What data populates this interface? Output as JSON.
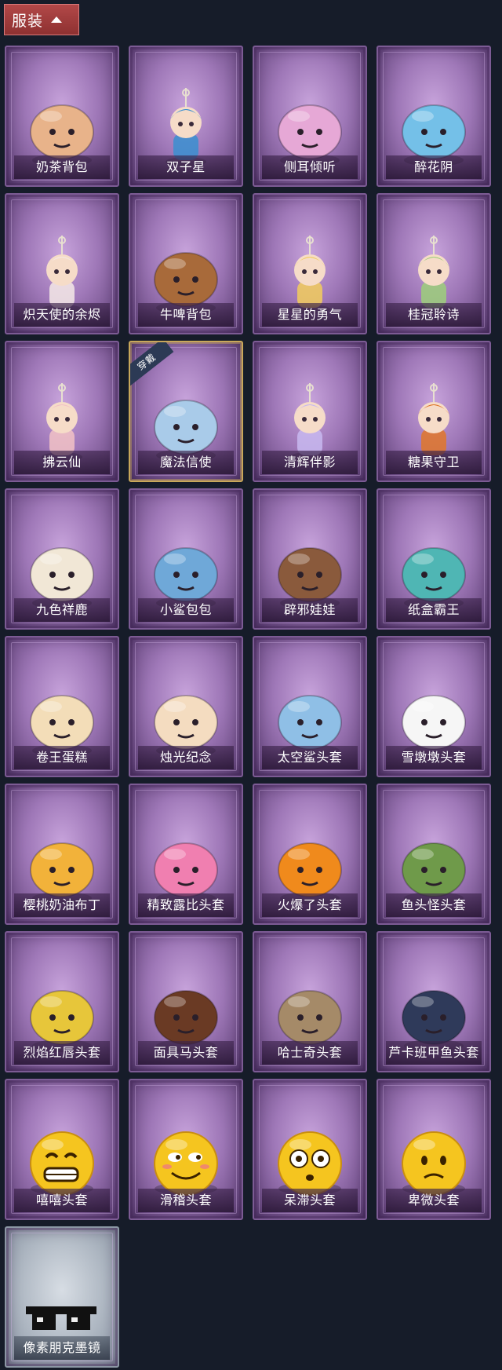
{
  "header": {
    "title": "服装"
  },
  "items": [
    {
      "label": "奶茶背包",
      "icon": "milk-tea-backpack-icon",
      "color": "#e8b38a"
    },
    {
      "label": "双子星",
      "icon": "twin-star-icon",
      "color": "#3a8fd0"
    },
    {
      "label": "侧耳倾听",
      "icon": "listening-wreath-icon",
      "color": "#e6a8d6"
    },
    {
      "label": "醉花阴",
      "icon": "flower-dreamcatcher-icon",
      "color": "#74c0e8"
    },
    {
      "label": "炽天使的余烬",
      "icon": "seraph-doll-icon",
      "color": "#f4e9e6"
    },
    {
      "label": "牛啤背包",
      "icon": "cow-beer-barrel-icon",
      "color": "#a86a3a"
    },
    {
      "label": "星星的勇气",
      "icon": "star-courage-doll-icon",
      "color": "#f2cd5c"
    },
    {
      "label": "桂冠聆诗",
      "icon": "laurel-doll-icon",
      "color": "#9ccf7a"
    },
    {
      "label": "拂云仙",
      "icon": "cloud-fairy-doll-icon",
      "color": "#f2c2c6"
    },
    {
      "label": "魔法信使",
      "icon": "magic-elephant-icon",
      "color": "#a9cbe9",
      "equipped": true,
      "badge": "穿戴"
    },
    {
      "label": "清辉伴影",
      "icon": "moonlight-doll-icon",
      "color": "#c8b8f0"
    },
    {
      "label": "糖果守卫",
      "icon": "pumpkin-scarecrow-icon",
      "color": "#e0772a"
    },
    {
      "label": "九色祥鹿",
      "icon": "nine-color-deer-icon",
      "color": "#f1e7d6"
    },
    {
      "label": "小鲨包包",
      "icon": "shark-bag-icon",
      "color": "#6fa8d8"
    },
    {
      "label": "辟邪娃娃",
      "icon": "girl-head-icon",
      "color": "#8a5a3c"
    },
    {
      "label": "纸盒霸王",
      "icon": "cardboard-dino-icon",
      "color": "#4fb6b4"
    },
    {
      "label": "卷王蛋糕",
      "icon": "swiss-roll-cake-icon",
      "color": "#f3ddb8"
    },
    {
      "label": "烛光纪念",
      "icon": "candle-icon",
      "color": "#f4dcc0"
    },
    {
      "label": "太空鲨头套",
      "icon": "space-shark-helmet-icon",
      "color": "#8fbfe6"
    },
    {
      "label": "雪墩墩头套",
      "icon": "snowman-helmet-icon",
      "color": "#f6f6f6"
    },
    {
      "label": "樱桃奶油布丁",
      "icon": "pudding-icon",
      "color": "#f2b23a"
    },
    {
      "label": "精致露比头套",
      "icon": "pink-bird-helmet-icon",
      "color": "#f07fb0"
    },
    {
      "label": "火爆了头套",
      "icon": "fire-spirit-helmet-icon",
      "color": "#f08a1c"
    },
    {
      "label": "鱼头怪头套",
      "icon": "fish-head-helmet-icon",
      "color": "#6f9a4a"
    },
    {
      "label": "烈焰红唇头套",
      "icon": "yellow-mask-helmet-icon",
      "color": "#e7c63a"
    },
    {
      "label": "面具马头套",
      "icon": "horse-mask-icon",
      "color": "#6a3a24"
    },
    {
      "label": "哈士奇头套",
      "icon": "husky-helmet-icon",
      "color": "#a58a68"
    },
    {
      "label": "芦卡班甲鱼头套",
      "icon": "fish-helmet-icon",
      "color": "#2f3a5a"
    },
    {
      "label": "嘻嘻头套",
      "icon": "grin-emoji-helmet-icon",
      "color": "#f5c51f"
    },
    {
      "label": "滑稽头套",
      "icon": "funny-emoji-helmet-icon",
      "color": "#f5c51f"
    },
    {
      "label": "呆滞头套",
      "icon": "dazed-emoji-helmet-icon",
      "color": "#f5c51f"
    },
    {
      "label": "卑微头套",
      "icon": "humble-emoji-helmet-icon",
      "color": "#f5c51f"
    },
    {
      "label": "像素朋克墨镜",
      "icon": "pixel-sunglasses-icon",
      "color": "#111111",
      "pale": true
    }
  ]
}
